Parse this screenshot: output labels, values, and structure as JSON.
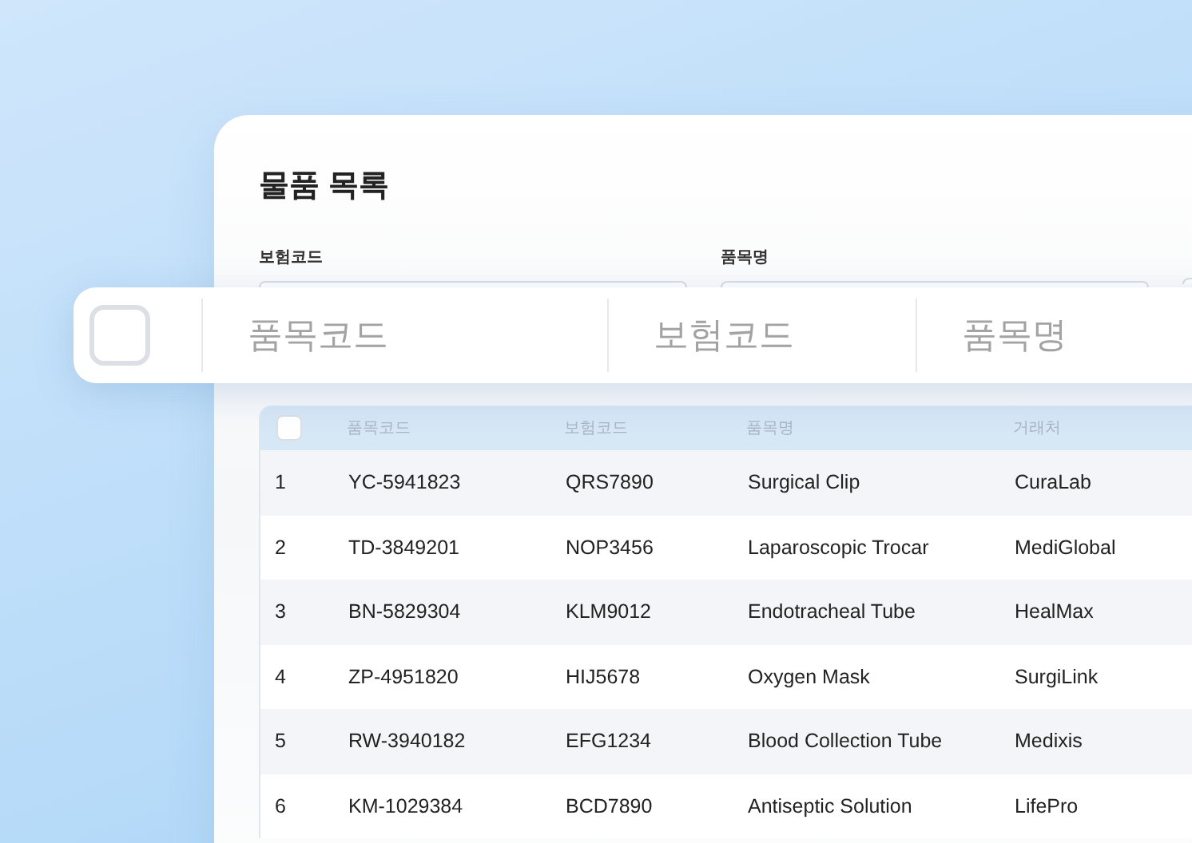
{
  "card": {
    "title": "물품 목록",
    "filters": [
      {
        "label": "보험코드"
      },
      {
        "label": "품목명"
      }
    ]
  },
  "table": {
    "checked": false,
    "columns": [
      "품목코드",
      "보험코드",
      "품목명",
      "거래처"
    ],
    "rows": [
      {
        "no": "1",
        "cells": [
          "YC-5941823",
          "QRS7890",
          "Surgical Clip",
          "CuraLab"
        ]
      },
      {
        "no": "2",
        "cells": [
          "TD-3849201",
          "NOP3456",
          "Laparoscopic Trocar",
          "MediGlobal"
        ]
      },
      {
        "no": "3",
        "cells": [
          "BN-5829304",
          "KLM9012",
          "Endotracheal Tube",
          "HealMax"
        ]
      },
      {
        "no": "4",
        "cells": [
          "ZP-4951820",
          "HIJ5678",
          "Oxygen Mask",
          "SurgiLink"
        ]
      },
      {
        "no": "5",
        "cells": [
          "RW-3940182",
          "EFG1234",
          "Blood Collection Tube",
          "Medixis"
        ]
      },
      {
        "no": "6",
        "cells": [
          "KM-1029384",
          "BCD7890",
          "Antiseptic Solution",
          "LifePro"
        ]
      }
    ]
  },
  "floating_header": {
    "checked": false,
    "columns": [
      "품목코드",
      "보험코드",
      "품목명"
    ]
  }
}
